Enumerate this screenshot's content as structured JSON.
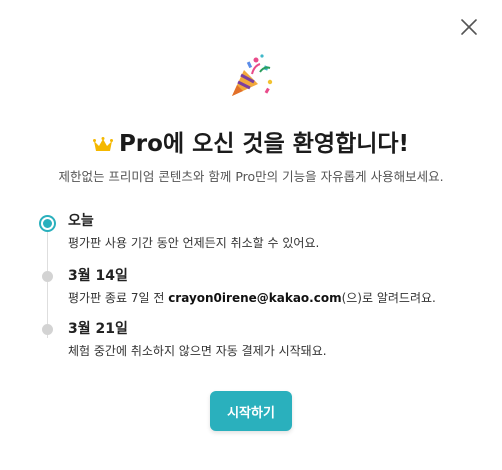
{
  "dialog": {
    "close_icon": "close-icon",
    "hero_icon": "party-popper-icon",
    "title_icon": "crown-icon",
    "title": "Pro에 오신 것을 환영합니다!",
    "subtitle": "제한없는 프리미엄 콘텐츠와 함께 Pro만의 기능을 자유롭게 사용해보세요.",
    "timeline": [
      {
        "title": "오늘",
        "desc": "평가판 사용 기간 동안 언제든지 취소할 수 있어요.",
        "active": true
      },
      {
        "title": "3월 14일",
        "desc_prefix": "평가판 종료 7일 전 ",
        "email": "crayon0irene@kakao.com",
        "desc_suffix": "(으)로 알려드려요.",
        "active": false
      },
      {
        "title": "3월 21일",
        "desc": "체험 중간에 취소하지 않으면 자동 결제가 시작돼요.",
        "active": false
      }
    ],
    "start_button": "시작하기"
  },
  "colors": {
    "accent": "#2ab0bd",
    "inactive_dot": "#d3d3d3",
    "crown": "#f5b800"
  }
}
